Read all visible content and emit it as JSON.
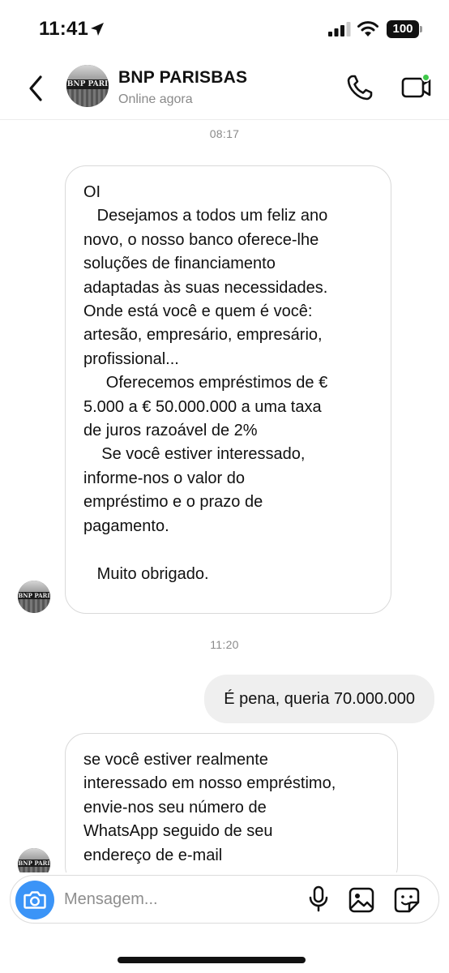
{
  "status_bar": {
    "time": "11:41",
    "battery": "100"
  },
  "header": {
    "avatar_text": "BNP PARI",
    "contact_name": "BNP PARISBAS",
    "contact_status": "Online agora"
  },
  "thread": {
    "timestamp_1": "08:17",
    "message_1": "OI\n   Desejamos a todos um feliz ano\nnovo, o nosso banco oferece-lhe\nsoluções de financiamento\nadaptadas às suas necessidades.\nOnde está você e quem é você:\nartesão, empresário, empresário,\nprofissional...\n     Oferecemos empréstimos de €\n5.000 a € 50.000.000 a uma taxa\nde juros razoável de 2%\n    Se você estiver interessado,\ninforme-nos o valor do\nempréstimo e o prazo de\npagamento.\n\n   Muito obrigado.",
    "timestamp_2": "11:20",
    "message_2": "É pena, queria 70.000.000",
    "message_3": "se você estiver realmente\ninteressado em nosso empréstimo,\nenvie-nos seu número de\nWhatsApp seguido de seu\nendereço de e-mail"
  },
  "composer": {
    "placeholder": "Mensagem..."
  },
  "colors": {
    "camera_button": "#3b94f7",
    "online_dot": "#3fc84a",
    "outgoing_bubble": "#efefef"
  }
}
